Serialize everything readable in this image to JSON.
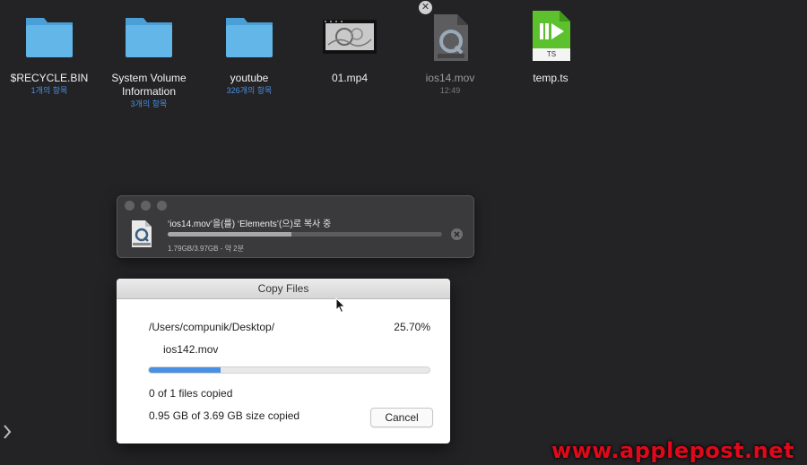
{
  "desktop": {
    "items": [
      {
        "name": "$RECYCLE.BIN",
        "sub": "1개의 항목",
        "icon": "folder-icon"
      },
      {
        "name": "System Volume\nInformation",
        "sub": "3개의 항목",
        "icon": "folder-icon"
      },
      {
        "name": "youtube",
        "sub": "326개의 항목",
        "icon": "folder-icon"
      },
      {
        "name": "01.mp4",
        "sub": "",
        "icon": "video-thumbnail"
      },
      {
        "name": "ios14.mov",
        "sub": "12:49",
        "icon": "quicktime-file-icon"
      },
      {
        "name": "temp.ts",
        "sub": "",
        "icon": "ts-file-icon",
        "badge": "TS"
      }
    ]
  },
  "progress_window": {
    "title": "‘ios14.mov’을(를) ‘Elements’(으)로 복사 중",
    "status": "1.79GB/3.97GB - 약 2분",
    "progress": 0.45
  },
  "copy_dialog": {
    "title": "Copy Files",
    "path": "/Users/compunik/Desktop/",
    "percent": "25.70%",
    "progress": 0.257,
    "file": "ios142.mov",
    "files_copied": "0 of 1 files copied",
    "size_copied": "0.95 GB of 3.69 GB size copied",
    "cancel_label": "Cancel"
  },
  "watermark": "www.applepost.net",
  "colors": {
    "accent": "#4a90e2",
    "folder": "#62b6e8",
    "watermark": "#e0091b"
  }
}
